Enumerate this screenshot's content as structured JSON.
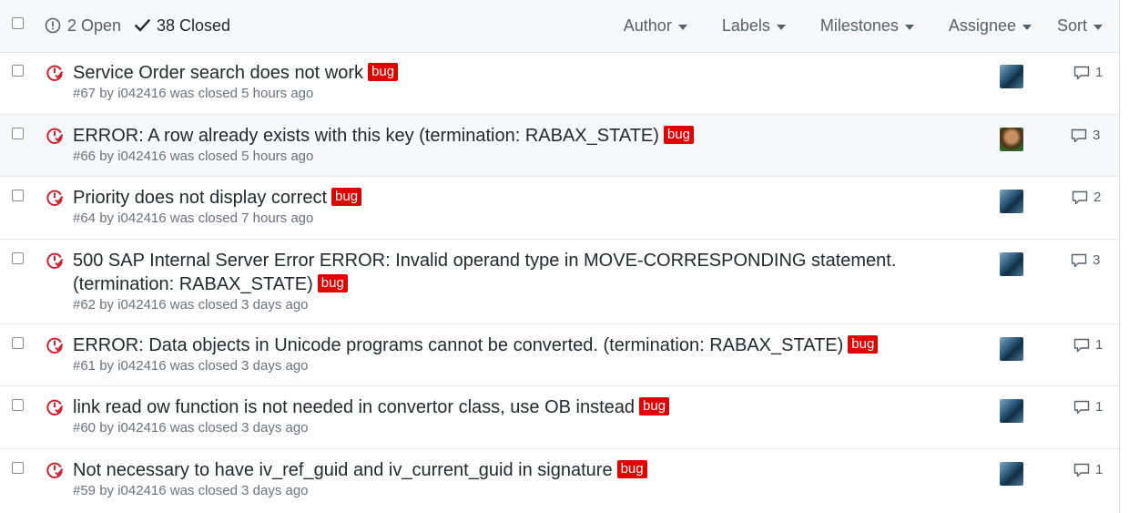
{
  "header": {
    "open_count_label": "2 Open",
    "closed_count_label": "38 Closed",
    "filters": [
      "Author",
      "Labels",
      "Milestones",
      "Assignee",
      "Sort"
    ]
  },
  "colors": {
    "bug_label": "#e00000",
    "closed_icon": "#cb2431"
  },
  "issues": [
    {
      "title": "Service Order search does not work",
      "label": "bug",
      "meta": "#67 by i042416 was closed 5 hours ago",
      "avatar": "teal-avatar",
      "comments": "1"
    },
    {
      "title": "ERROR: A row already exists with this key (termination: RABAX_STATE)",
      "label": "bug",
      "meta": "#66 by i042416 was closed 5 hours ago",
      "avatar": "person-avatar",
      "comments": "3"
    },
    {
      "title": "Priority does not display correct",
      "label": "bug",
      "meta": "#64 by i042416 was closed 7 hours ago",
      "avatar": "teal-avatar",
      "comments": "2"
    },
    {
      "title": "500 SAP Internal Server Error ERROR: Invalid operand type in MOVE-CORRESPONDING statement. (termination: RABAX_STATE)",
      "label": "bug",
      "meta": "#62 by i042416 was closed 3 days ago",
      "avatar": "teal-avatar",
      "comments": "3"
    },
    {
      "title": "ERROR: Data objects in Unicode programs cannot be converted. (termination: RABAX_STATE)",
      "label": "bug",
      "meta": "#61 by i042416 was closed 3 days ago",
      "avatar": "teal-avatar",
      "comments": "1"
    },
    {
      "title": "link read ow function is not needed in convertor class, use OB instead",
      "label": "bug",
      "meta": "#60 by i042416 was closed 3 days ago",
      "avatar": "teal-avatar",
      "comments": "1"
    },
    {
      "title": "Not necessary to have iv_ref_guid and iv_current_guid in signature",
      "label": "bug",
      "meta": "#59 by i042416 was closed 3 days ago",
      "avatar": "teal-avatar",
      "comments": "1"
    }
  ]
}
